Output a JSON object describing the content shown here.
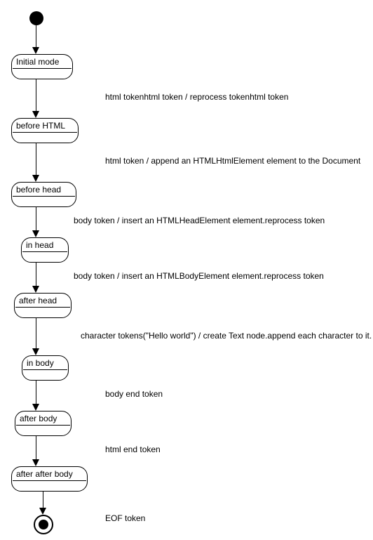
{
  "chart_data": {
    "type": "state-diagram",
    "title": "",
    "start_node": true,
    "end_node": true,
    "states": [
      {
        "id": "initial_mode",
        "label": "Initial mode"
      },
      {
        "id": "before_html",
        "label": "before HTML"
      },
      {
        "id": "before_head",
        "label": "before head"
      },
      {
        "id": "in_head",
        "label": "in head"
      },
      {
        "id": "after_head",
        "label": "after head"
      },
      {
        "id": "in_body",
        "label": "in body"
      },
      {
        "id": "after_body",
        "label": "after body"
      },
      {
        "id": "after_after_body",
        "label": "after after body"
      }
    ],
    "transitions": [
      {
        "from": "start",
        "to": "initial_mode",
        "label": ""
      },
      {
        "from": "initial_mode",
        "to": "before_html",
        "label": "html tokenhtml token / reprocess tokenhtml token"
      },
      {
        "from": "before_html",
        "to": "before_head",
        "label": "html token / append an HTMLHtmlElement element to the Document"
      },
      {
        "from": "before_head",
        "to": "in_head",
        "label": "body token / insert an HTMLHeadElement element.reprocess token"
      },
      {
        "from": "in_head",
        "to": "after_head",
        "label": "body token / insert an HTMLBodyElement element.reprocess token"
      },
      {
        "from": "after_head",
        "to": "in_body",
        "label": "character tokens(\"Hello world\") / create Text node.append each character to it."
      },
      {
        "from": "in_body",
        "to": "after_body",
        "label": "body end token"
      },
      {
        "from": "after_body",
        "to": "after_after_body",
        "label": "html end token"
      },
      {
        "from": "after_after_body",
        "to": "end",
        "label": "EOF token"
      }
    ]
  }
}
